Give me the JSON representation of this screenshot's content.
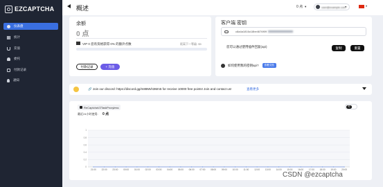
{
  "brand": {
    "name": "EZCAPTCHA"
  },
  "sidebar": {
    "items": [
      {
        "label": "仪表盘",
        "icon": "dashboard-icon",
        "active": true
      },
      {
        "label": "统计",
        "icon": "stats-icon",
        "active": false
      },
      {
        "label": "充值",
        "icon": "cart-icon",
        "active": false
      },
      {
        "label": "委托",
        "icon": "user-icon",
        "active": false
      },
      {
        "label": "付款记录",
        "icon": "calendar-icon",
        "active": false
      },
      {
        "label": "通知",
        "icon": "bell-icon",
        "active": false
      }
    ]
  },
  "header": {
    "title": "概述",
    "badge_count": "0 点",
    "user_email": "user@example.com"
  },
  "balance": {
    "title": "余额",
    "amount": "0 点",
    "vip_text": "VIP 0 您有资格获得 0% 的额外点数",
    "next_level": "距离下一等级: $5",
    "progress": 0,
    "history_button": "付款记录",
    "recharge_button": "+ 充值"
  },
  "client": {
    "title": "客户端 密钥",
    "key_prefix": "c8a4a1816c18be4676f09",
    "hint": "您可以通过使用插件回复(api)",
    "copy_button": "复制",
    "reset_button": "重置",
    "info_text": "如何使用我的密钥api?",
    "info_badge": "查看文档"
  },
  "announcement": {
    "text": "🔗 Join our discord: https://discord.gg/m88Mvh3Mm5 for receive 10000 free points! Join and contact us!",
    "link": "查看更多"
  },
  "chart_card": {
    "task_name": "ReCaptchaV2TaskProxyless",
    "recent_label": "最近24小时使用:",
    "recent_value": "0 点",
    "toggle_label": "时"
  },
  "chart_data": {
    "type": "area",
    "x": [
      "21:00",
      "22:00",
      "23:00",
      "00:00",
      "01:00",
      "02:00",
      "03:00",
      "04:00",
      "05:00",
      "06:00",
      "07:00",
      "08:00",
      "09:00",
      "10:00",
      "11:00",
      "12:00",
      "13:00",
      "14:00",
      "15:00",
      "16:00",
      "17:00",
      "18:00",
      "19:00",
      "20:00"
    ],
    "series": [
      {
        "values": [
          0,
          0,
          0,
          0,
          0,
          0,
          0,
          0,
          0,
          0,
          0,
          0,
          0,
          0,
          0,
          0,
          0,
          0,
          0,
          0,
          0,
          0,
          0,
          0
        ]
      }
    ],
    "y_ticks": [
      "1",
      "0.8",
      "0.6",
      "0.4",
      "0.2",
      "0"
    ],
    "ylim": [
      0,
      1
    ],
    "grid": true
  },
  "watermark": "CSDN @ezcaptcha"
}
